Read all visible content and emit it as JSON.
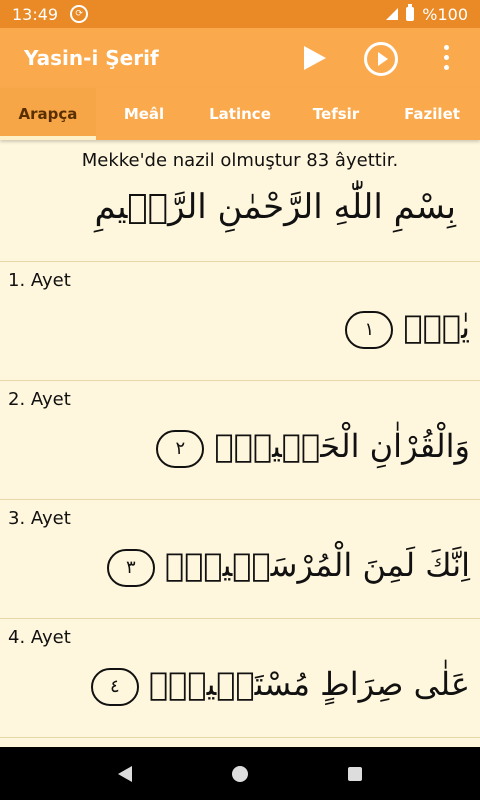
{
  "status": {
    "time": "13:49",
    "battery": "%100"
  },
  "appbar": {
    "title": "Yasin-i Şerif",
    "icons": [
      "play-icon",
      "play-circle-icon",
      "more-vert-icon"
    ]
  },
  "tabs": [
    {
      "label": "Arapça",
      "active": true
    },
    {
      "label": "Meâl",
      "active": false
    },
    {
      "label": "Latince",
      "active": false
    },
    {
      "label": "Tefsir",
      "active": false
    },
    {
      "label": "Fazilet",
      "active": false
    }
  ],
  "content": {
    "info": "Mekke'de nazil olmuştur 83 âyettir.",
    "basmala": "بِسْمِ اللّٰهِ الرَّحْمٰنِ الرَّح۪يمِ",
    "ayahs": [
      {
        "title": "1. Ayet",
        "text": "يٰسٓۜ",
        "number": "١"
      },
      {
        "title": "2. Ayet",
        "text": "وَالْقُرْاٰنِ الْحَك۪يمِۙ",
        "number": "٢"
      },
      {
        "title": "3. Ayet",
        "text": "اِنَّكَ لَمِنَ الْمُرْسَل۪ينَۙ",
        "number": "٣"
      },
      {
        "title": "4. Ayet",
        "text": "عَلٰى صِرَاطٍ مُسْتَق۪يمٍۜ",
        "number": "٤"
      }
    ]
  },
  "colors": {
    "statusbar": "#E98A26",
    "appbar": "#FBA94D",
    "background": "#FFF7DD"
  }
}
